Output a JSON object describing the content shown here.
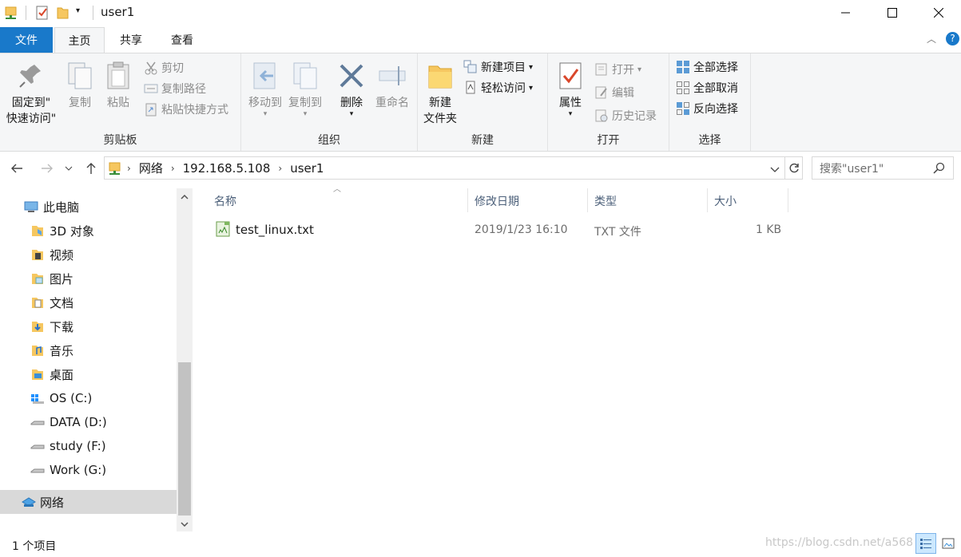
{
  "window": {
    "title": "user1"
  },
  "ribbon_tabs": [
    {
      "label": "文件"
    },
    {
      "label": "主页"
    },
    {
      "label": "共享"
    },
    {
      "label": "查看"
    }
  ],
  "ribbon": {
    "clipboard": {
      "label": "剪贴板",
      "pin": "固定到\"\n快速访问\"",
      "pin_line1": "固定到\"",
      "pin_line2": "快速访问\"",
      "copy": "复制",
      "paste": "粘贴",
      "cut": "剪切",
      "copy_path": "复制路径",
      "paste_shortcut": "粘贴快捷方式"
    },
    "organize": {
      "label": "组织",
      "move_to": "移动到",
      "copy_to": "复制到",
      "delete": "删除",
      "rename": "重命名"
    },
    "new": {
      "label": "新建",
      "new_folder_line1": "新建",
      "new_folder_line2": "文件夹",
      "new_item": "新建项目",
      "easy_access": "轻松访问"
    },
    "open": {
      "label": "打开",
      "properties": "属性",
      "open": "打开",
      "edit": "编辑",
      "history": "历史记录"
    },
    "select": {
      "label": "选择",
      "select_all": "全部选择",
      "select_none": "全部取消",
      "invert": "反向选择"
    }
  },
  "address": {
    "crumbs": [
      "网络",
      "192.168.5.108",
      "user1"
    ]
  },
  "search": {
    "placeholder": "搜索\"user1\""
  },
  "nav_pane": {
    "items": [
      {
        "label": "此电脑",
        "icon": "pc-icon"
      },
      {
        "label": "3D 对象",
        "icon": "3d-objects-icon"
      },
      {
        "label": "视频",
        "icon": "videos-icon"
      },
      {
        "label": "图片",
        "icon": "pictures-icon"
      },
      {
        "label": "文档",
        "icon": "documents-icon"
      },
      {
        "label": "下载",
        "icon": "downloads-icon"
      },
      {
        "label": "音乐",
        "icon": "music-icon"
      },
      {
        "label": "桌面",
        "icon": "desktop-icon"
      },
      {
        "label": "OS (C:)",
        "icon": "windows-drive-icon"
      },
      {
        "label": "DATA (D:)",
        "icon": "drive-icon"
      },
      {
        "label": "study (F:)",
        "icon": "drive-icon"
      },
      {
        "label": "Work (G:)",
        "icon": "drive-icon"
      },
      {
        "label": "网络",
        "icon": "network-icon",
        "selected": true
      }
    ]
  },
  "file_list": {
    "columns": [
      "名称",
      "修改日期",
      "类型",
      "大小"
    ],
    "rows": [
      {
        "name": "test_linux.txt",
        "modified": "2019/1/23 16:10",
        "type": "TXT 文件",
        "size": "1 KB"
      }
    ]
  },
  "status": {
    "count": "1 个项目",
    "watermark": "https://blog.csdn.net/a568"
  },
  "colors": {
    "file_tab": "#1979ca",
    "selection": "#d9d9d9",
    "accent_red": "#d9472b"
  }
}
